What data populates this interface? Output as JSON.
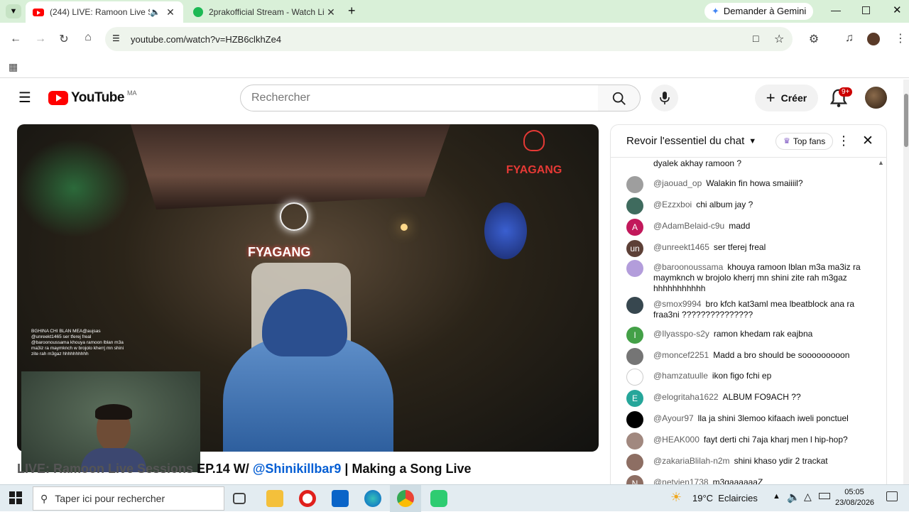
{
  "browser": {
    "tabs": [
      {
        "title": "(244) LIVE: Ramoon Live Se",
        "active": true
      },
      {
        "title": "2prakofficial Stream - Watch Li",
        "active": false
      }
    ],
    "gemini_label": "Demander à Gemini",
    "url": "youtube.com/watch?v=HZB6clkhZe4"
  },
  "youtube": {
    "logo_text": "YouTube",
    "region": "MA",
    "search_placeholder": "Rechercher",
    "create_label": "Créer",
    "notification_count": "9+",
    "video_title_prefix": "LIVE: Ramoon Live Sessions",
    "video_title_episode": "EP.14 W/",
    "video_title_link": "@Shinikillbar9",
    "video_title_sep": "|",
    "video_title_suffix": "Making a Song Live",
    "overlay_brand": "FYAGANG"
  },
  "chat": {
    "header_title": "Revoir l'essentiel du chat",
    "top_fans_label": "Top fans",
    "first_line": "dyalek akhay ramoon ?",
    "messages": [
      {
        "author": "@jaouad_op",
        "text": "Walakin fin howa smaiiiil?",
        "avatar_letter": "",
        "color": "#9e9e9e"
      },
      {
        "author": "@Ezzxboi",
        "text": "chi album jay ?",
        "avatar_letter": "",
        "color": "#3f6b5e"
      },
      {
        "author": "@AdamBelaid-c9u",
        "text": "madd",
        "avatar_letter": "A",
        "color": "#c2185b"
      },
      {
        "author": "@unreekt1465",
        "text": "ser tferej freal",
        "avatar_letter": "un",
        "color": "#5d4037"
      },
      {
        "author": "@baroonoussama",
        "text": "khouya ramoon lblan m3a ma3iz ra maymknch w brojolo kherrj mn shini zite rah m3gaz hhhhhhhhhhh",
        "avatar_letter": "",
        "color": "#b39ddb"
      },
      {
        "author": "@smox9994",
        "text": "bro kfch kat3aml mea lbeatblock ana ra fraa3ni ???????????????",
        "avatar_letter": "",
        "color": "#37474f"
      },
      {
        "author": "@Ilyasspo-s2y",
        "text": "ramon khedam rak eajbna",
        "avatar_letter": "I",
        "color": "#43a047"
      },
      {
        "author": "@moncef2251",
        "text": "Madd a bro should be sooooooooon",
        "avatar_letter": "",
        "color": "#757575"
      },
      {
        "author": "@hamzatuulle",
        "text": "ikon figo fchi ep",
        "avatar_letter": "",
        "color": "#ffffff"
      },
      {
        "author": "@elogritaha1622",
        "text": "ALBUM FO9ACH ??",
        "avatar_letter": "E",
        "color": "#26a69a"
      },
      {
        "author": "@Ayour97",
        "text": "lla ja shini 3lemoo kifaach iweli ponctuel",
        "avatar_letter": "",
        "color": "#000000"
      },
      {
        "author": "@HEAK000",
        "text": "fayt derti chi 7aja kharj men l hip-hop?",
        "avatar_letter": "",
        "color": "#a1887f"
      },
      {
        "author": "@zakariaBlilah-n2m",
        "text": "shini khaso ydir 2 trackat",
        "avatar_letter": "",
        "color": "#8d6e63"
      },
      {
        "author": "@netvien1738",
        "text": "m3gaaaaaaZ",
        "avatar_letter": "N",
        "color": "#8d6e63"
      }
    ]
  },
  "stream_overlay": {
    "chat_lines": [
      "BGHINA CHI BLAN MEA@aujsas",
      "@unreekt1465   ser tferej freal",
      "@baroonoussama   khouya ramoon lblan m3a ma3iz ra maymknch w brojolo kherrj mn shini zite rah m3gaz hhhhhhhhhh"
    ]
  },
  "taskbar": {
    "search_placeholder": "Taper ici pour rechercher",
    "weather": "19°C  Eclaircies",
    "time": "05:05",
    "date": "23/08/2026"
  }
}
